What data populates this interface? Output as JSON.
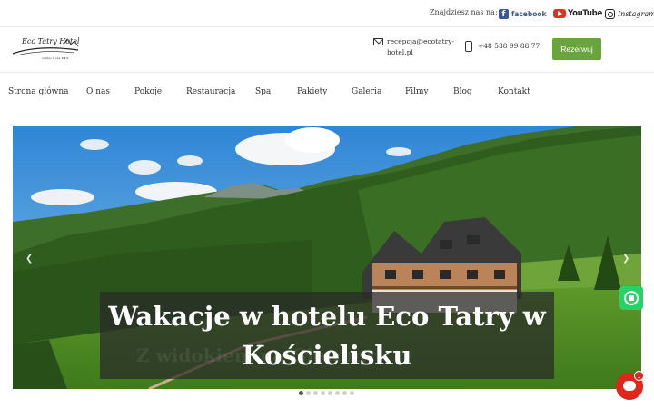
{
  "topbar": {
    "find_us": "Znajdziesz nas na:",
    "social": [
      {
        "icon": "facebook-icon",
        "label": "facebook",
        "color": "#3b5998"
      },
      {
        "icon": "youtube-icon",
        "label": "YouTube",
        "color": "#e52d27"
      },
      {
        "icon": "instagram-icon",
        "label": "Instagram",
        "color": "#222222"
      }
    ]
  },
  "header": {
    "logo_text": "Eco Tatry Hotel",
    "logo_sub": "holiday & spa ★★★",
    "email": "recepcja@ecotatry-hotel.pl",
    "phone": "+48 538 99 88 77",
    "book_label": "Rezerwuj",
    "accent_color": "#6aa43d"
  },
  "nav": {
    "items": [
      "Strona główna",
      "O nas",
      "Pokoje",
      "Restauracja",
      "Spa",
      "Pakiety",
      "Galeria",
      "Filmy",
      "Blog",
      "Kontakt"
    ]
  },
  "hero": {
    "title": "Wakacje w hotelu Eco Tatry w Kościelisku",
    "ghost_text": "Z widokiem na Giewont",
    "prev_icon": "chevron-left-icon",
    "next_icon": "chevron-right-icon",
    "slides_total": 8,
    "active_slide": 1
  },
  "floating": {
    "whatsapp_icon": "whatsapp-icon",
    "chat_icon": "chat-icon",
    "chat_badge": "1"
  }
}
